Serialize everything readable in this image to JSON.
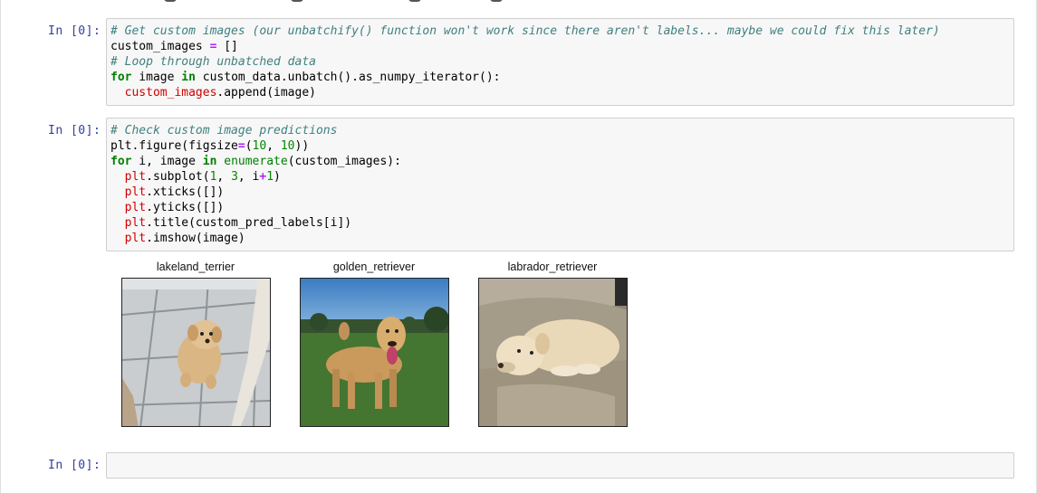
{
  "cells": [
    {
      "prompt": "In [0]:",
      "lines": [
        [
          {
            "t": "comment",
            "v": "# Get custom images (our unbatchify() function won't work since there aren't labels... maybe we could fix this later)"
          }
        ],
        [
          {
            "t": "plain",
            "v": "custom_images "
          },
          {
            "t": "op",
            "v": "="
          },
          {
            "t": "plain",
            "v": " []"
          }
        ],
        [
          {
            "t": "comment",
            "v": "# Loop through unbatched data"
          }
        ],
        [
          {
            "t": "kw",
            "v": "for"
          },
          {
            "t": "plain",
            "v": " image "
          },
          {
            "t": "kw",
            "v": "in"
          },
          {
            "t": "plain",
            "v": " custom_data.unbatch().as_numpy_iterator():"
          }
        ],
        [
          {
            "t": "plain",
            "v": "  "
          },
          {
            "t": "var",
            "v": "custom_images"
          },
          {
            "t": "plain",
            "v": ".append(image)"
          }
        ]
      ]
    },
    {
      "prompt": "In [0]:",
      "lines": [
        [
          {
            "t": "comment",
            "v": "# Check custom image predictions"
          }
        ],
        [
          {
            "t": "plain",
            "v": "plt.figure(figsize"
          },
          {
            "t": "op",
            "v": "="
          },
          {
            "t": "plain",
            "v": "("
          },
          {
            "t": "num",
            "v": "10"
          },
          {
            "t": "plain",
            "v": ", "
          },
          {
            "t": "num",
            "v": "10"
          },
          {
            "t": "plain",
            "v": "))"
          }
        ],
        [
          {
            "t": "kw",
            "v": "for"
          },
          {
            "t": "plain",
            "v": " i, image "
          },
          {
            "t": "kw",
            "v": "in"
          },
          {
            "t": "plain",
            "v": " "
          },
          {
            "t": "builtin",
            "v": "enumerate"
          },
          {
            "t": "plain",
            "v": "(custom_images):"
          }
        ],
        [
          {
            "t": "plain",
            "v": "  "
          },
          {
            "t": "var",
            "v": "plt"
          },
          {
            "t": "plain",
            "v": ".subplot("
          },
          {
            "t": "num",
            "v": "1"
          },
          {
            "t": "plain",
            "v": ", "
          },
          {
            "t": "num",
            "v": "3"
          },
          {
            "t": "plain",
            "v": ", i"
          },
          {
            "t": "op",
            "v": "+"
          },
          {
            "t": "num",
            "v": "1"
          },
          {
            "t": "plain",
            "v": ")"
          }
        ],
        [
          {
            "t": "plain",
            "v": "  "
          },
          {
            "t": "var",
            "v": "plt"
          },
          {
            "t": "plain",
            "v": ".xticks([])"
          }
        ],
        [
          {
            "t": "plain",
            "v": "  "
          },
          {
            "t": "var",
            "v": "plt"
          },
          {
            "t": "plain",
            "v": ".yticks([])"
          }
        ],
        [
          {
            "t": "plain",
            "v": "  "
          },
          {
            "t": "var",
            "v": "plt"
          },
          {
            "t": "plain",
            "v": ".title(custom_pred_labels[i])"
          }
        ],
        [
          {
            "t": "plain",
            "v": "  "
          },
          {
            "t": "var",
            "v": "plt"
          },
          {
            "t": "plain",
            "v": ".imshow(image)"
          }
        ]
      ]
    },
    {
      "prompt": "In [0]:",
      "lines": []
    }
  ],
  "figures": [
    {
      "title": "lakeland_terrier",
      "icon": "dog-on-tiles-photo"
    },
    {
      "title": "golden_retriever",
      "icon": "dog-on-grass-photo"
    },
    {
      "title": "labrador_retriever",
      "icon": "dog-on-couch-photo"
    }
  ],
  "colors": {
    "prompt": "#303f9f",
    "comment": "#408080",
    "keyword": "#008000",
    "operator": "#aa22ff",
    "variable": "#d00000"
  }
}
